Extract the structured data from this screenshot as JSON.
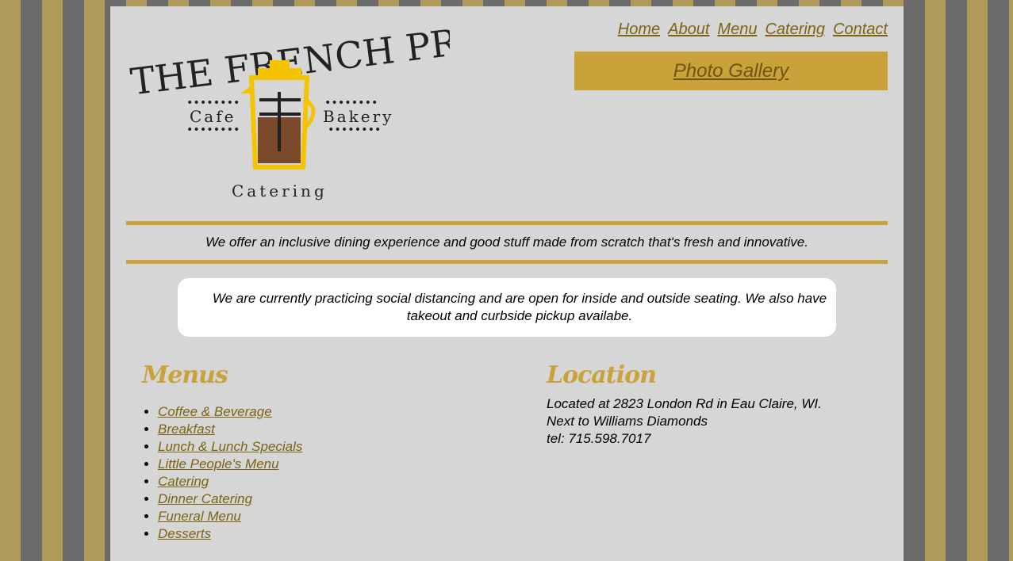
{
  "logo": {
    "title": "THE FRENCH PRESS",
    "left_text": "Cafe",
    "right_text": "Bakery",
    "bottom_text": "Catering"
  },
  "nav": {
    "items": [
      {
        "label": "Home"
      },
      {
        "label": "About"
      },
      {
        "label": "Menu"
      },
      {
        "label": "Catering"
      },
      {
        "label": "Contact"
      }
    ],
    "gallery_label": "Photo Gallery"
  },
  "tagline": "We offer an inclusive dining experience and good stuff made from scratch that's fresh and innovative.",
  "notice": "We are currently practicing social distancing and are open for inside and outside seating. We also have takeout and curbside pickup availabe.",
  "menus": {
    "title": "Menus",
    "items": [
      {
        "label": "Coffee & Beverage"
      },
      {
        "label": "Breakfast"
      },
      {
        "label": "Lunch & Lunch Specials"
      },
      {
        "label": "Little People's Menu"
      },
      {
        "label": "Catering"
      },
      {
        "label": "Dinner Catering"
      },
      {
        "label": "Funeral Menu"
      },
      {
        "label": "Desserts"
      }
    ]
  },
  "location": {
    "title": "Location",
    "line1": "Located at 2823 London Rd in Eau Claire, WI.",
    "line2": "Next to Williams Diamonds",
    "line3": "tel: 715.598.7017"
  },
  "colors": {
    "gold": "#c9a23a",
    "link": "#7a6412",
    "panel": "#d6d6d6",
    "stripe_gold": "#b09a5a",
    "stripe_gray": "#6b6b6b"
  }
}
